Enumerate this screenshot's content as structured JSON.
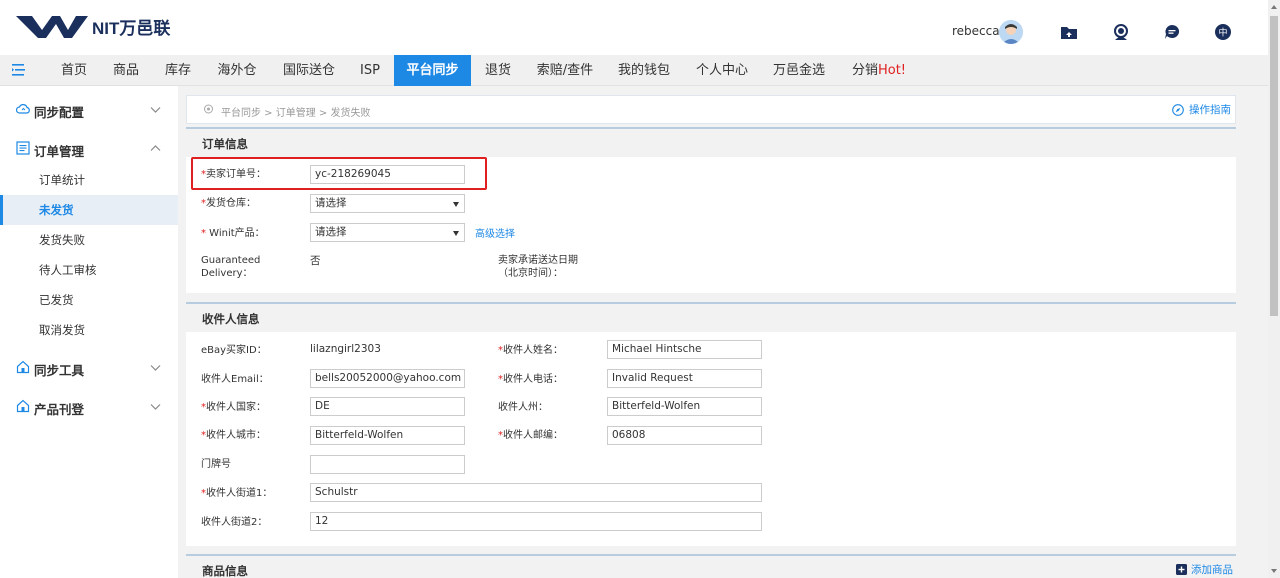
{
  "header": {
    "logo_text": "NIT万邑联",
    "username": "rebecca",
    "icons": [
      "folder-icon",
      "support-icon",
      "chat-icon",
      "language-icon"
    ],
    "language_label": "中"
  },
  "nav": {
    "items": [
      "首页",
      "商品",
      "库存",
      "海外仓",
      "国际送仓",
      "ISP",
      "平台同步",
      "退货",
      "索赔/查件",
      "我的钱包",
      "个人中心",
      "万邑金选",
      "分销"
    ],
    "hot_label": "Hot!",
    "active": "平台同步"
  },
  "sidebar": {
    "groups": [
      {
        "label": "同步配置",
        "icon": "cloud-sync-icon",
        "expanded": false
      },
      {
        "label": "订单管理",
        "icon": "list-icon",
        "expanded": true,
        "items": [
          "订单统计",
          "未发货",
          "发货失败",
          "待人工审核",
          "已发货",
          "取消发货"
        ]
      },
      {
        "label": "同步工具",
        "icon": "home-tool-icon",
        "expanded": false
      },
      {
        "label": "产品刊登",
        "icon": "home-publish-icon",
        "expanded": false
      }
    ],
    "active_item": "未发货"
  },
  "breadcrumb": "平台同步 > 订单管理 > 发货失败",
  "guide_label": "操作指南",
  "order_info": {
    "title": "订单信息",
    "seller_order_label": "卖家订单号：",
    "seller_order_value": "yc-218269045",
    "warehouse_label": "发货仓库：",
    "warehouse_value": "请选择",
    "winit_product_label": " Winit产品：",
    "winit_product_value": "请选择",
    "advanced_select": "高级选择",
    "guaranteed_label_1": "Guaranteed",
    "guaranteed_label_2": "Delivery：",
    "guaranteed_value": "否",
    "promise_date_label_1": "卖家承诺送达日期",
    "promise_date_label_2": "（北京时间）："
  },
  "recipient": {
    "title": "收件人信息",
    "ebay_id_label": "eBay买家ID：",
    "ebay_id_value": "lilazngirl2303",
    "name_label": "收件人姓名：",
    "name_value": "Michael Hintsche",
    "email_label": "收件人Email：",
    "email_value": "bells20052000@yahoo.com",
    "phone_label": "收件人电话：",
    "phone_value": "Invalid Request",
    "country_label": "收件人国家：",
    "country_value": "DE",
    "state_label": "收件人州：",
    "state_value": "Bitterfeld-Wolfen",
    "city_label": "收件人城市：",
    "city_value": "Bitterfeld-Wolfen",
    "zip_label": "收件人邮编：",
    "zip_value": "06808",
    "house_no_label": "门牌号",
    "house_no_value": "",
    "street1_label": "收件人街道1：",
    "street1_value": "Schulstr",
    "street2_label": "收件人街道2：",
    "street2_value": "12"
  },
  "goods": {
    "title": "商品信息",
    "add_label": "添加商品"
  },
  "colors": {
    "accent": "#1e88e5",
    "required": "#e02020",
    "brand": "#1b2f5c"
  }
}
